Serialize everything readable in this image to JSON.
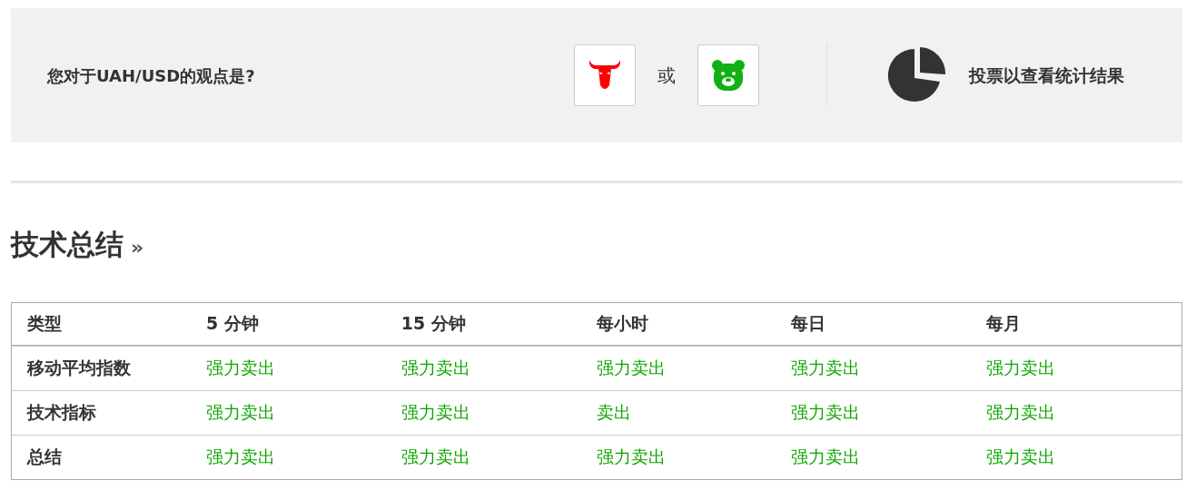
{
  "sentiment_poll": {
    "question": "您对于UAH/USD的观点是?",
    "separator": "或",
    "results_label": "投票以查看统计结果"
  },
  "section": {
    "title": "技术总结",
    "more": "»"
  },
  "table": {
    "columns": [
      "类型",
      "5 分钟",
      "15 分钟",
      "每小时",
      "每日",
      "每月"
    ],
    "rows": [
      {
        "cells": [
          "移动平均指数",
          "强力卖出",
          "强力卖出",
          "强力卖出",
          "强力卖出",
          "强力卖出"
        ]
      },
      {
        "cells": [
          "技术指标",
          "强力卖出",
          "强力卖出",
          "卖出",
          "强力卖出",
          "强力卖出"
        ]
      },
      {
        "cells": [
          "总结",
          "强力卖出",
          "强力卖出",
          "强力卖出",
          "强力卖出",
          "强力卖出"
        ]
      }
    ]
  }
}
